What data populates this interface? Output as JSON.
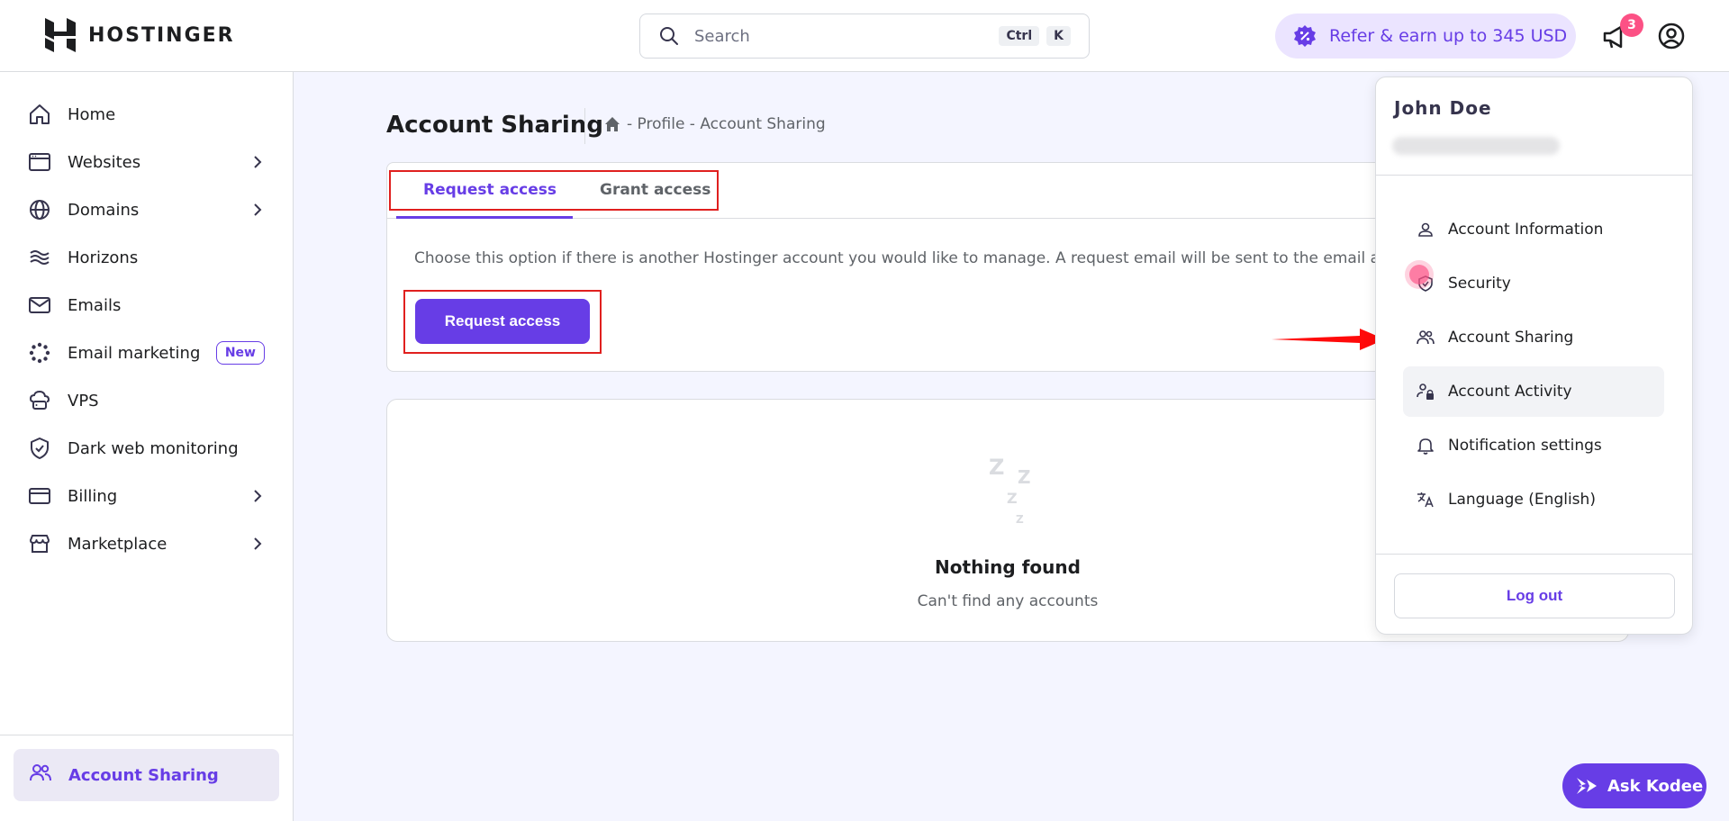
{
  "header": {
    "brand": "HOSTINGER",
    "search_placeholder": "Search",
    "shortcut_keys": [
      "Ctrl",
      "K"
    ],
    "refer_label": "Refer & earn up to 345 USD",
    "notification_count": "3"
  },
  "sidebar": {
    "items": [
      {
        "label": "Home"
      },
      {
        "label": "Websites"
      },
      {
        "label": "Domains"
      },
      {
        "label": "Horizons"
      },
      {
        "label": "Emails"
      },
      {
        "label": "Email marketing",
        "badge": "New"
      },
      {
        "label": "VPS"
      },
      {
        "label": "Dark web monitoring"
      },
      {
        "label": "Billing"
      },
      {
        "label": "Marketplace"
      }
    ],
    "active": {
      "label": "Account Sharing"
    }
  },
  "main": {
    "title": "Account Sharing",
    "breadcrumb": "- Profile - Account Sharing",
    "tabs": [
      {
        "label": "Request access",
        "active": true
      },
      {
        "label": "Grant access",
        "active": false
      }
    ],
    "description": "Choose this option if there is another Hostinger account you would like to manage. A request email will be sent to the email address.",
    "request_button": "Request access",
    "empty": {
      "title": "Nothing found",
      "subtitle": "Can't find any accounts"
    }
  },
  "dropdown": {
    "user_name": "John Doe",
    "items": [
      {
        "label": "Account Information"
      },
      {
        "label": "Security"
      },
      {
        "label": "Account Sharing"
      },
      {
        "label": "Account Activity"
      },
      {
        "label": "Notification settings"
      },
      {
        "label": "Language (English)"
      }
    ],
    "logout": "Log out"
  },
  "assistant": {
    "label": "Ask Kodee"
  },
  "colors": {
    "accent": "#673de6",
    "highlight_box": "#e0201f",
    "badge": "#fc5185"
  }
}
